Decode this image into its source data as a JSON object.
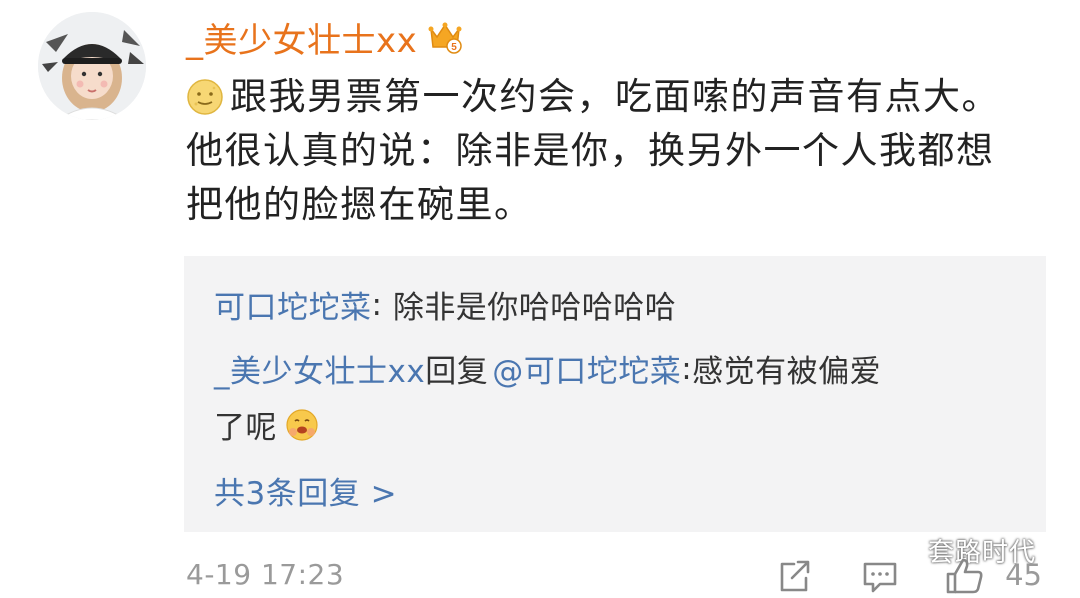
{
  "comment": {
    "username": "_美少女壮士xx",
    "badge_icon": "crown-vip-icon",
    "text_lines": [
      "跟我男票第一次约会，吃面嗦的声音有点大。",
      "他很认真的说：除非是你，换另外一个人我都想",
      "把他的脸摁在碗里。"
    ],
    "leading_emoji": "smiling-moon-emoji",
    "timestamp": "4-19 17:23",
    "like_count": "45"
  },
  "replies": {
    "items": [
      {
        "author": "可口坨坨菜",
        "separator": ": ",
        "text": "除非是你哈哈哈哈哈"
      },
      {
        "author": "_美少女壮士xx",
        "reply_word": "回复",
        "mention": "@可口坨坨菜",
        "separator": ":",
        "text_line1": "感觉有被偏爱",
        "text_line2": "了呢",
        "emoji": "hugging-face-emoji"
      }
    ],
    "more_label": "共3条回复 >"
  },
  "watermark": {
    "text": "套路时代",
    "icon": "wechat-icon"
  },
  "colors": {
    "username": "#e8731c",
    "link": "#4a76b0",
    "body_text": "#222222",
    "muted": "#9a9a9a",
    "reply_bg": "#f3f3f4"
  }
}
